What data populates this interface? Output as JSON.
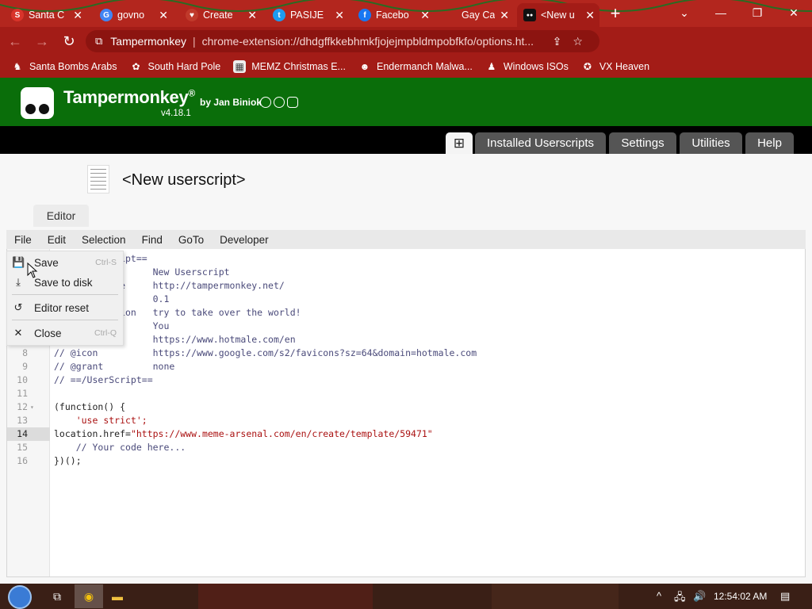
{
  "browser": {
    "tabs": [
      {
        "title": "Santa C",
        "favicon_color": "#d9342b",
        "favicon_glyph": "S"
      },
      {
        "title": "govno",
        "favicon_color": "#4285f4",
        "favicon_glyph": "G"
      },
      {
        "title": "Create",
        "favicon_color": "#c0392b",
        "favicon_glyph": "♥"
      },
      {
        "title": "PASIJE",
        "favicon_color": "#1d9bf0",
        "favicon_glyph": "t"
      },
      {
        "title": "Facebo",
        "favicon_color": "#1877f2",
        "favicon_glyph": "f"
      },
      {
        "title": "Gay Ca",
        "favicon_color": "#d9342b",
        "favicon_glyph": ""
      },
      {
        "title": "<New u",
        "favicon_color": "#111111",
        "favicon_glyph": "●●"
      }
    ],
    "close_glyph": "✕",
    "new_tab_glyph": "+",
    "window_controls": {
      "list": "⌄",
      "minimize": "—",
      "restore": "❐",
      "close": "✕"
    },
    "omnibox": {
      "site": "Tampermonkey",
      "separator": "|",
      "url": "chrome-extension://dhdgffkkebhmkfjojejmpbldmpobfkfo/options.ht..."
    },
    "toolbar_icons": {
      "back": "←",
      "forward": "→",
      "reload": "↻",
      "extension": "⧉",
      "share": "⇪",
      "star": "☆",
      "puzzle": "✚",
      "sidebar": "▯",
      "profile": "●",
      "menu": "⋮"
    },
    "extension_badges": [
      "",
      "S",
      "",
      "◎"
    ],
    "bookmarks": [
      {
        "label": "Santa Bombs Arabs",
        "icon": "♞"
      },
      {
        "label": "South Hard Pole",
        "icon": "✿"
      },
      {
        "label": "MEMZ Christmas E...",
        "icon": "▦"
      },
      {
        "label": "Endermanch Malwa...",
        "icon": "☻"
      },
      {
        "label": "Windows ISOs",
        "icon": "♟"
      },
      {
        "label": "VX Heaven",
        "icon": "✪"
      }
    ]
  },
  "tampermonkey": {
    "brand": "Tampermonkey",
    "registered": "®",
    "author": "by Jan Biniok",
    "version": "v4.18.1",
    "social_icons": [
      "github-icon",
      "facebook-icon",
      "instagram-icon"
    ],
    "nav": {
      "add_glyph": "⊞",
      "installed": "Installed Userscripts",
      "settings": "Settings",
      "utilities": "Utilities",
      "help": "Help"
    },
    "script_title": "<New userscript>",
    "editor_tab": "Editor",
    "menubar": [
      "File",
      "Edit",
      "Selection",
      "Find",
      "GoTo",
      "Developer"
    ],
    "file_menu": [
      {
        "label": "Save",
        "shortcut": "Ctrl-S",
        "icon": "💾"
      },
      {
        "label": "Save to disk",
        "shortcut": "",
        "icon": "⤓"
      },
      {
        "label": "Editor reset",
        "shortcut": "",
        "icon": "↺"
      },
      {
        "label": "Close",
        "shortcut": "Ctrl-Q",
        "icon": "✕"
      }
    ],
    "code_lines": [
      {
        "n": "1",
        "pre": "// ==UserScript==",
        "pre_cls": "c-com",
        "val": "",
        "val_cls": ""
      },
      {
        "n": "2",
        "pre": "// @name          ",
        "pre_cls": "c-com",
        "val": "New Userscript",
        "val_cls": "c-com"
      },
      {
        "n": "3",
        "pre": "// @namespace     ",
        "pre_cls": "c-com",
        "val": "http://tampermonkey.net/",
        "val_cls": "c-com"
      },
      {
        "n": "4",
        "pre": "// @version       ",
        "pre_cls": "c-com",
        "val": "0.1",
        "val_cls": "c-com"
      },
      {
        "n": "5",
        "pre": "// @description   ",
        "pre_cls": "c-com",
        "val": "try to take over the world!",
        "val_cls": "c-com"
      },
      {
        "n": "6",
        "pre": "// @author        ",
        "pre_cls": "c-com",
        "val": "You",
        "val_cls": "c-com"
      },
      {
        "n": "7",
        "pre": "// @match         ",
        "pre_cls": "c-com",
        "val": "https://www.hotmale.com/en",
        "val_cls": "c-com"
      },
      {
        "n": "8",
        "pre": "// @icon          ",
        "pre_cls": "c-com",
        "val": "https://www.google.com/s2/favicons?sz=64&domain=hotmale.com",
        "val_cls": "c-com"
      },
      {
        "n": "9",
        "pre": "// @grant         ",
        "pre_cls": "c-com",
        "val": "none",
        "val_cls": "c-com"
      },
      {
        "n": "10",
        "pre": "// ==/UserScript==",
        "pre_cls": "c-com",
        "val": "",
        "val_cls": ""
      },
      {
        "n": "11",
        "pre": "",
        "pre_cls": "",
        "val": "",
        "val_cls": ""
      },
      {
        "n": "12",
        "pre": "(function() {",
        "pre_cls": "",
        "val": "",
        "val_cls": "",
        "fold": "▾"
      },
      {
        "n": "13",
        "pre": "    ",
        "pre_cls": "",
        "val": "'use strict';",
        "val_cls": "c-str"
      },
      {
        "n": "14",
        "pre": "location.href=",
        "pre_cls": "",
        "val": "\"https://www.meme-arsenal.com/en/create/template/59471\"",
        "val_cls": "c-str",
        "current": true
      },
      {
        "n": "15",
        "pre": "    ",
        "pre_cls": "",
        "val": "// Your code here...",
        "val_cls": "c-com"
      },
      {
        "n": "16",
        "pre": "})();",
        "pre_cls": "",
        "val": "",
        "val_cls": ""
      }
    ]
  },
  "taskbar": {
    "clock": "12:54:02 AM",
    "tray_icons": {
      "chevron": "^",
      "network": "🖧",
      "volume": "🔊",
      "notifications": "▤"
    },
    "apps": {
      "taskview": "⧉",
      "chrome": "◉",
      "explorer": "▬"
    }
  },
  "colors": {
    "chrome_red": "#a31c17",
    "tm_green": "#0a6e0a",
    "tm_tab": "#555555"
  }
}
